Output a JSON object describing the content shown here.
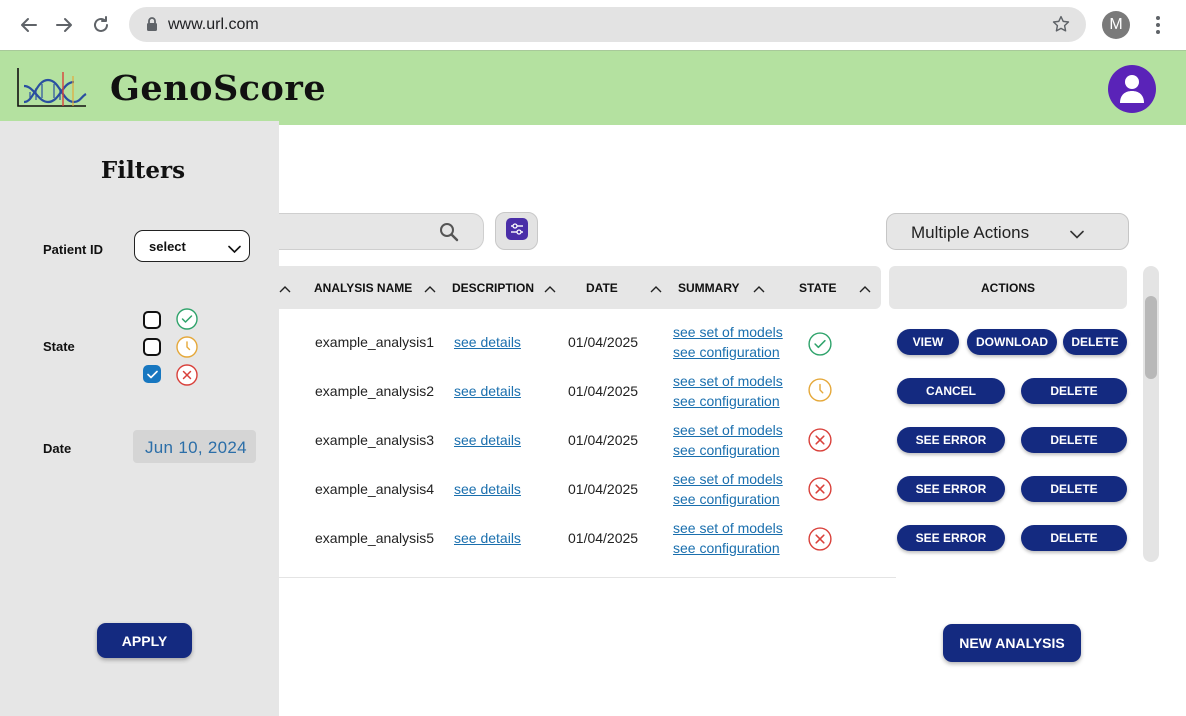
{
  "browser": {
    "url": "www.url.com",
    "profile_initial": "M"
  },
  "app": {
    "title": "GenoScore",
    "header_color": "#b4e1a0",
    "accent_color": "#142a80"
  },
  "filters": {
    "title": "Filters",
    "patient_id_label": "Patient ID",
    "patient_id_value": "select",
    "state_label": "State",
    "states": [
      {
        "icon": "success-check-icon",
        "checked": false,
        "color": "#2fa36b"
      },
      {
        "icon": "pending-clock-icon",
        "checked": false,
        "color": "#e5a83a"
      },
      {
        "icon": "error-x-icon",
        "checked": true,
        "color": "#d9413b"
      }
    ],
    "date_label": "Date",
    "date_value": "Jun 10, 2024",
    "apply_label": "APPLY"
  },
  "toolbar": {
    "search_icon": "search-icon",
    "filter_icon": "sliders-icon",
    "multiple_actions_label": "Multiple Actions"
  },
  "table": {
    "columns": [
      "ANALYSIS NAME",
      "DESCRIPTION",
      "DATE",
      "SUMMARY",
      "STATE"
    ],
    "actions_header": "ACTIONS",
    "rows": [
      {
        "name": "example_analysis1",
        "description": "see details",
        "date": "01/04/2025",
        "summary_models": "see set of models",
        "summary_config": "see configuration",
        "state": "success",
        "actions": [
          "VIEW",
          "DOWNLOAD",
          "DELETE"
        ]
      },
      {
        "name": "example_analysis2",
        "description": "see details",
        "date": "01/04/2025",
        "summary_models": "see set of models",
        "summary_config": "see configuration",
        "state": "pending",
        "actions": [
          "CANCEL",
          "DELETE"
        ]
      },
      {
        "name": "example_analysis3",
        "description": "see details",
        "date": "01/04/2025",
        "summary_models": "see set of models",
        "summary_config": "see configuration",
        "state": "error",
        "actions": [
          "SEE ERROR",
          "DELETE"
        ]
      },
      {
        "name": "example_analysis4",
        "description": "see details",
        "date": "01/04/2025",
        "summary_models": "see set of models",
        "summary_config": "see configuration",
        "state": "error",
        "actions": [
          "SEE ERROR",
          "DELETE"
        ]
      },
      {
        "name": "example_analysis5",
        "description": "see details",
        "date": "01/04/2025",
        "summary_models": "see set of models",
        "summary_config": "see configuration",
        "state": "error",
        "actions": [
          "SEE ERROR",
          "DELETE"
        ]
      }
    ]
  },
  "new_analysis_label": "NEW ANALYSIS"
}
